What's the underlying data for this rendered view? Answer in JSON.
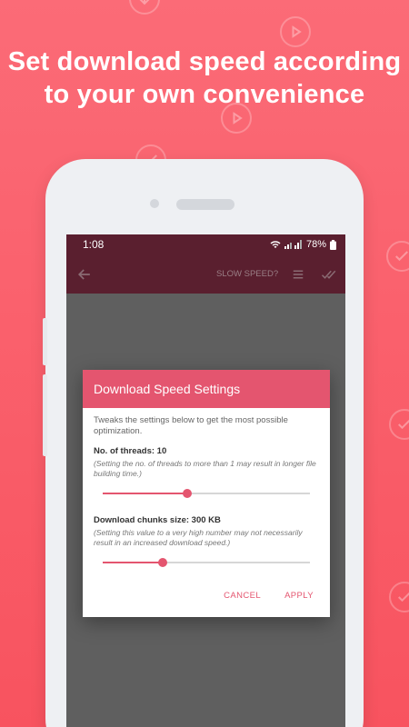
{
  "headline": {
    "line1": "Set download speed according",
    "line2": "to your own convenience"
  },
  "status_bar": {
    "time": "1:08",
    "battery": "78%"
  },
  "toolbar": {
    "title": "SLOW SPEED?",
    "back_icon": "arrow-left-icon",
    "menu_icon": "list-icon",
    "done_icon": "double-check-icon"
  },
  "dialog": {
    "title": "Download Speed Settings",
    "description": "Tweaks the settings below to get the most possible optimization.",
    "threads": {
      "label": "No. of threads: 10",
      "note": "(Setting the no. of threads to more than 1 may result in longer file building time.)",
      "slider_fraction": 0.41
    },
    "chunks": {
      "label": "Download chunks size: 300 KB",
      "note": "(Setting this value to a very high number may not necessarily result in an increased download speed.)",
      "slider_fraction": 0.29
    },
    "cancel_label": "CANCEL",
    "apply_label": "APPLY"
  },
  "colors": {
    "background": "#f95f6b",
    "toolbar": "#5a1f2f",
    "accent": "#e4556f"
  }
}
